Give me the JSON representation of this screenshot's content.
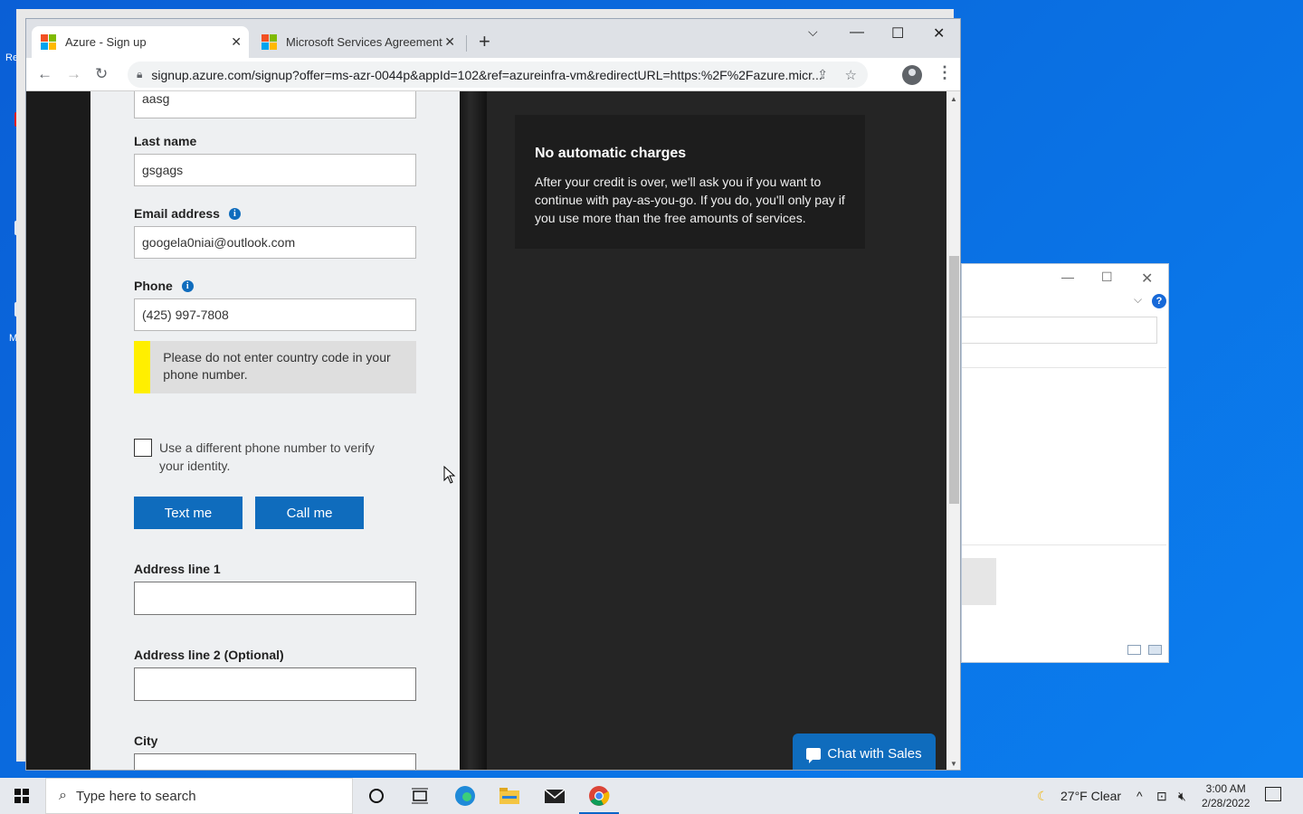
{
  "browser": {
    "tabs": [
      {
        "label": "Azure - Sign up",
        "active": true
      },
      {
        "label": "Microsoft Services Agreement",
        "active": false
      }
    ],
    "url": "signup.azure.com/signup?offer=ms-azr-0044p&appId=102&ref=azureinfra-vm&redirectURL=https:%2F%2Fazure.micr..."
  },
  "form": {
    "first_name_value": "aasg",
    "last_name_label": "Last name",
    "last_name_value": "gsgags",
    "email_label": "Email address",
    "email_value": "googela0niai@outlook.com",
    "phone_label": "Phone",
    "phone_value": "(425) 997-7808",
    "phone_warning": "Please do not enter country code in your phone number.",
    "different_phone_label": "Use a different phone number to verify your identity.",
    "text_me_label": "Text me",
    "call_me_label": "Call me",
    "address1_label": "Address line 1",
    "address2_label": "Address line 2 (Optional)",
    "city_label": "City"
  },
  "info_card": {
    "title": "No automatic charges",
    "body": "After your credit is over, we'll ask you if you want to continue with pay-as-you-go. If you do, you'll only pay if you use more than the free amounts of services."
  },
  "chat": {
    "label": "Chat with Sales"
  },
  "taskbar": {
    "search_placeholder": "Type here to search",
    "weather": "27°F  Clear",
    "time": "3:00 AM",
    "date": "2/28/2022"
  },
  "colors": {
    "accent": "#0f6cbd",
    "warning": "#ffef00"
  }
}
